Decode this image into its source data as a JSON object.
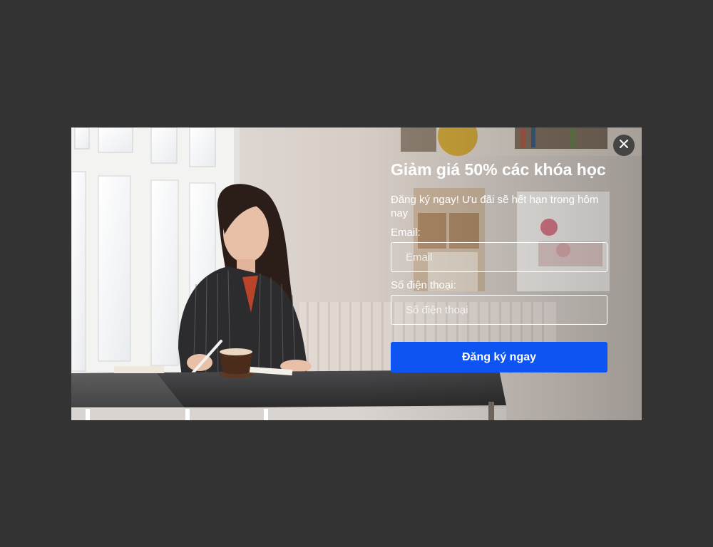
{
  "popup": {
    "title": "Giảm giá 50% các khóa học",
    "subtitle": "Đăng ký ngay! Ưu đãi sẽ hết hạn trong hôm nay",
    "email_label": "Email:",
    "email_placeholder": "Email",
    "email_value": "",
    "phone_label": "Số điện thoại:",
    "phone_placeholder": "Số điện thoại",
    "phone_value": "",
    "submit_label": "Đăng ký ngay",
    "close_icon": "close-icon"
  },
  "colors": {
    "backdrop": "#333333",
    "button": "#0d54f2",
    "close_bg": "#444444",
    "text": "#ffffff"
  }
}
